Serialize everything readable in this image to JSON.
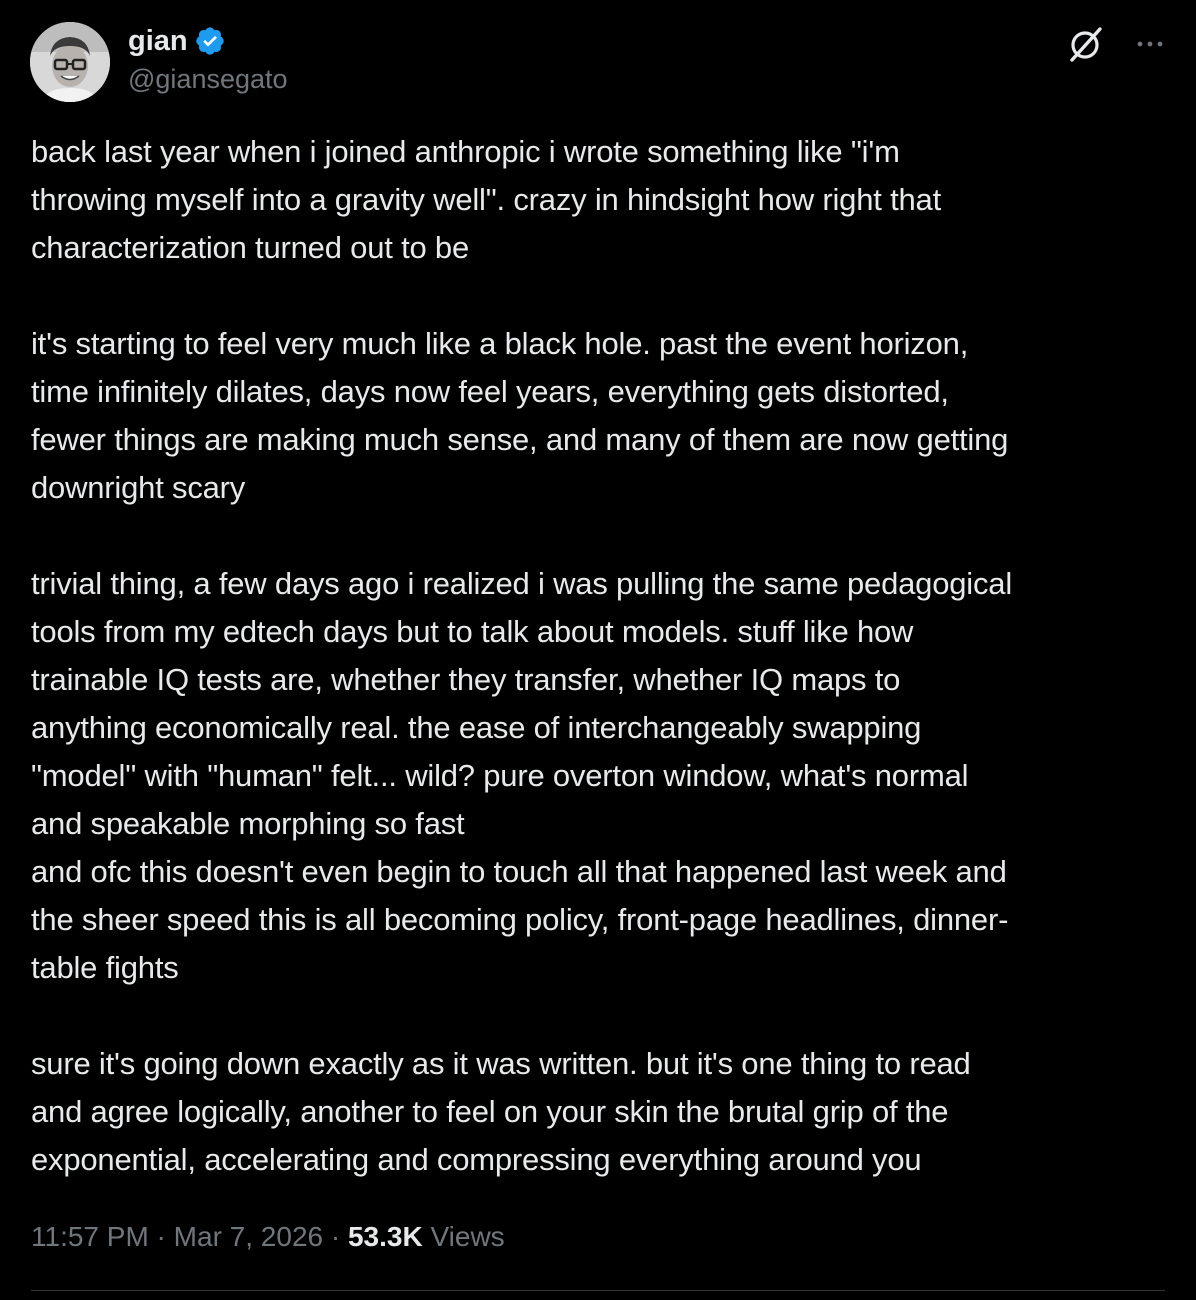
{
  "author": {
    "display_name": "gian",
    "handle": "@giansegato",
    "verified": true,
    "verified_color": "#1d9bf0",
    "avatar_icon": "profile-photo"
  },
  "header_icons": {
    "grok": "grok-icon",
    "more": "more-icon"
  },
  "tweet": {
    "paragraphs": [
      {
        "lines": [
          "back last year when i joined anthropic i wrote something like \"i'm",
          "throwing myself into a gravity well\". crazy in hindsight how right that",
          "characterization turned out to be"
        ]
      },
      {
        "lines": [
          "it's starting to feel very much like a black hole. past the event horizon,",
          "time infinitely dilates, days now feel years, everything gets distorted,",
          "fewer things are making much sense, and many of them are now getting",
          "downright scary"
        ]
      },
      {
        "lines": [
          "trivial thing, a few days ago i realized i was pulling the same pedagogical",
          "tools from my edtech days but to talk about models. stuff like how",
          "trainable IQ tests are, whether they transfer, whether IQ maps to",
          "anything economically real. the ease of interchangeably swapping",
          "\"model\" with \"human\" felt... wild? pure overton window, what's normal",
          "and speakable morphing so fast",
          "and ofc this doesn't even begin to touch all that happened last week and",
          "the sheer speed this is all becoming policy, front-page headlines, dinner-",
          "table fights"
        ]
      },
      {
        "lines": [
          "sure it's going down exactly as it was written. but it's one thing to read",
          "and agree logically, another to feel on your skin the brutal grip of the",
          "exponential, accelerating and compressing everything around you"
        ]
      }
    ]
  },
  "meta": {
    "time": "11:57 PM",
    "separator": " · ",
    "date": "Mar 7, 2026",
    "views_count": "53.3K",
    "views_label": "Views"
  },
  "colors": {
    "background": "#000000",
    "text": "#e7e9ea",
    "secondary": "#71767b",
    "accent": "#1d9bf0"
  }
}
